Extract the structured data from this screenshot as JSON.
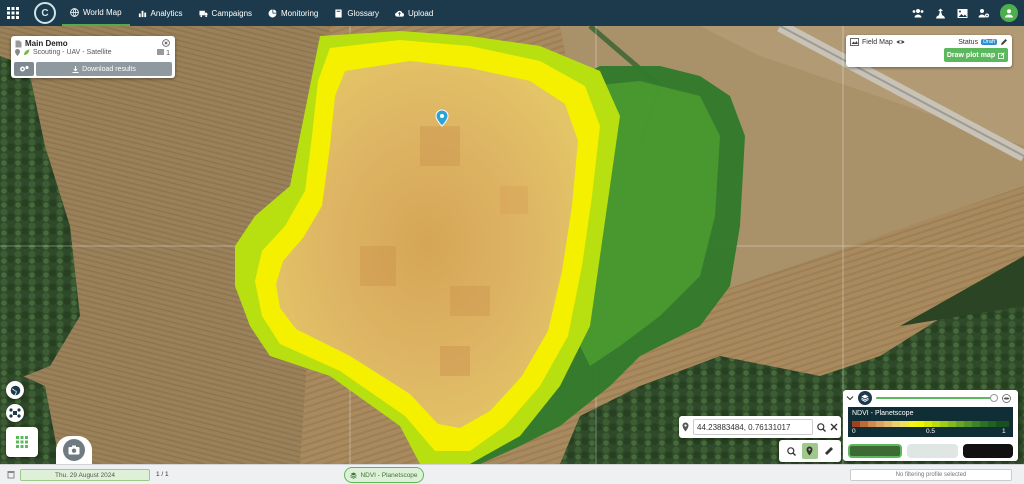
{
  "nav": {
    "items": [
      {
        "label": "World Map",
        "icon": "globe-icon",
        "active": true
      },
      {
        "label": "Analytics",
        "icon": "bar-chart-icon",
        "active": false
      },
      {
        "label": "Campaigns",
        "icon": "truck-icon",
        "active": false
      },
      {
        "label": "Monitoring",
        "icon": "pie-chart-icon",
        "active": false
      },
      {
        "label": "Glossary",
        "icon": "book-icon",
        "active": false
      },
      {
        "label": "Upload",
        "icon": "cloud-upload-icon",
        "active": false
      }
    ]
  },
  "project": {
    "title": "Main Demo",
    "subtitle": "Scouting - UAV - Satellite",
    "count": "1",
    "download_label": "Download results"
  },
  "field_map": {
    "title": "Field Map",
    "status_label": "Status",
    "status_badge": "Draft",
    "draw_label": "Draw plot map"
  },
  "coordinates": {
    "value": "44.23883484, 0.76131017"
  },
  "layer": {
    "name": "NDVI - Planetscope",
    "opacity": 0.97,
    "scale_min": "0",
    "scale_mid": "0.5",
    "scale_max": "1"
  },
  "bottom": {
    "date": "Thu. 29 August 2024",
    "page": "1 / 1",
    "layer_pill": "NDVI - Planetscope",
    "filter_text": "No filtering profile selected"
  },
  "colors": {
    "topbar": "#1d3a4c",
    "accent": "#5cb85c",
    "draft_badge": "#2a8fd4"
  }
}
